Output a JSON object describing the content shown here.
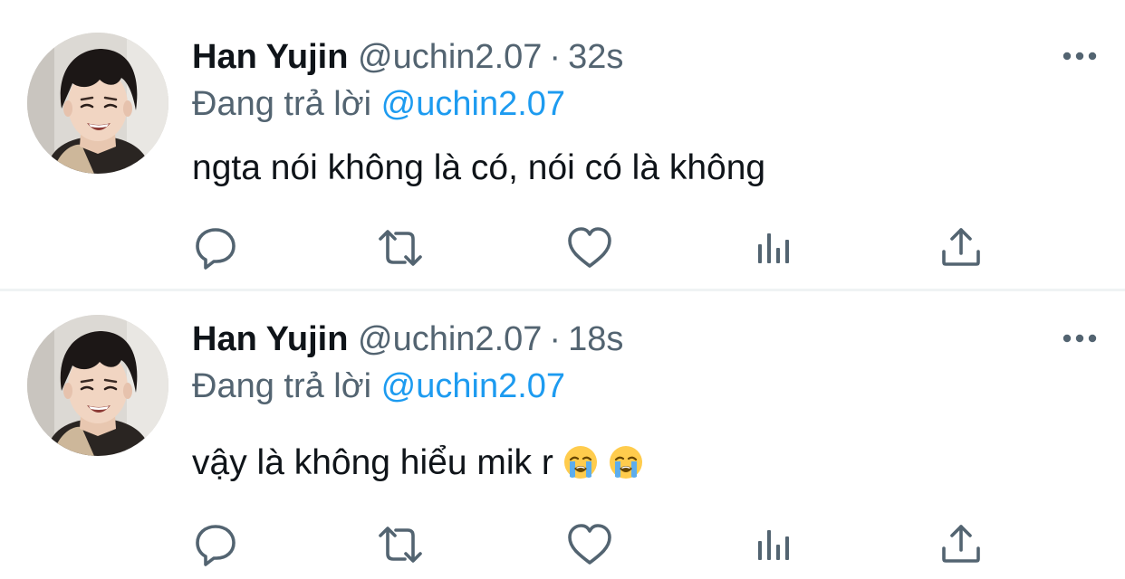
{
  "tweets": [
    {
      "display_name": "Han Yujin",
      "handle": "@uchin2.07",
      "separator": "·",
      "time": "32s",
      "reply_prefix": "Đang trả lời",
      "reply_to": "@uchin2.07",
      "text": "ngta nói không là có, nói có là không",
      "emojis": [],
      "more_icon": "more-horizontal-icon",
      "actions": [
        "reply-icon",
        "retweet-icon",
        "like-heart-icon",
        "view-stats-icon",
        "share-icon"
      ]
    },
    {
      "display_name": "Han Yujin",
      "handle": "@uchin2.07",
      "separator": "·",
      "time": "18s",
      "reply_prefix": "Đang trả lời",
      "reply_to": "@uchin2.07",
      "text": "vậy là không hiểu mik r",
      "emojis": [
        "loudly-crying-face",
        "loudly-crying-face"
      ],
      "more_icon": "more-horizontal-icon",
      "actions": [
        "reply-icon",
        "retweet-icon",
        "like-heart-icon",
        "view-stats-icon",
        "share-icon"
      ]
    }
  ],
  "colors": {
    "text_primary": "#0f1419",
    "text_secondary": "#536471",
    "mention_link": "#1d9bf0",
    "divider": "#eff3f4"
  }
}
